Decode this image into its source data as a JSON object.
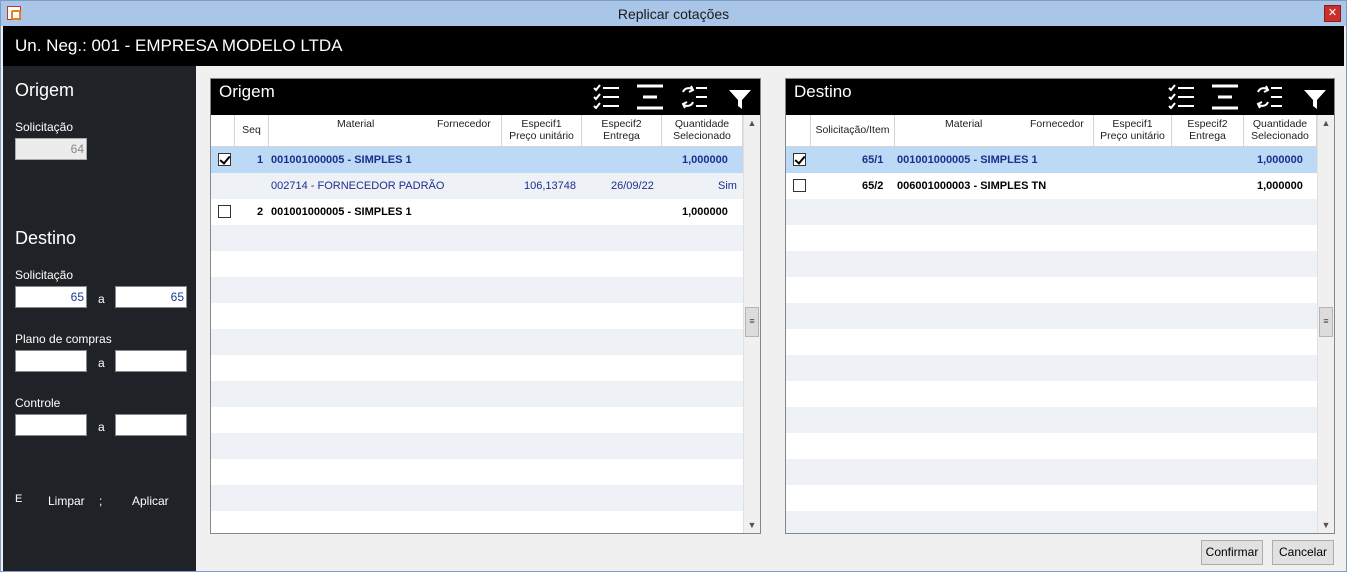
{
  "window": {
    "title": "Replicar cotações"
  },
  "company": {
    "label": "Un. Neg.:  001 - EMPRESA MODELO LTDA"
  },
  "sidebar": {
    "origem_title": "Origem",
    "origem_solicitacao_label": "Solicitação",
    "origem_solicitacao_value": "64",
    "destino_title": "Destino",
    "destino_solicitacao_label": "Solicitação",
    "destino_solicitacao_from": "65",
    "destino_solicitacao_to": "65",
    "plano_label": "Plano de compras",
    "plano_from": "",
    "plano_to": "",
    "controle_label": "Controle",
    "controle_from": "",
    "controle_to": "",
    "range_sep": "a",
    "link_e": "E",
    "link_limpar": "Limpar",
    "link_semicolon": ";",
    "link_aplicar": "Aplicar"
  },
  "origem_grid": {
    "title": "Origem",
    "columns": {
      "seq": "Seq",
      "material": "Material",
      "fornecedor": "Fornecedor",
      "espec1": "Especif1",
      "preco": "Preço unitário",
      "espec2": "Especif2",
      "entrega": "Entrega",
      "quantidade": "Quantidade",
      "selecionado": "Selecionado"
    },
    "rows": [
      {
        "seq": "1",
        "material": "001001000005 - SIMPLES 1",
        "quantidade": "1,000000",
        "checked": true
      },
      {
        "fornecedor": "002714 - FORNECEDOR PADRÃO",
        "preco": "106,13748",
        "entrega": "26/09/22",
        "selecionado": "Sim"
      },
      {
        "seq": "2",
        "material": "001001000005 - SIMPLES 1",
        "quantidade": "1,000000",
        "checked": false
      }
    ]
  },
  "destino_grid": {
    "title": "Destino",
    "columns": {
      "solicitacao_item": "Solicitação/Item",
      "material": "Material",
      "fornecedor": "Fornecedor",
      "espec1": "Especif1",
      "preco": "Preço unitário",
      "espec2": "Especif2",
      "entrega": "Entrega",
      "quantidade": "Quantidade",
      "selecionado": "Selecionado"
    },
    "rows": [
      {
        "item": "65/1",
        "material": "001001000005 - SIMPLES 1",
        "quantidade": "1,000000",
        "checked": true
      },
      {
        "item": "65/2",
        "material": "006001000003 - SIMPLES TN",
        "quantidade": "1,000000",
        "checked": false
      }
    ]
  },
  "buttons": {
    "confirmar": "Confirmar",
    "cancelar": "Cancelar"
  },
  "icons": {
    "check_all": "check-list-icon",
    "collapse": "align-lines-icon",
    "refresh": "refresh-list-icon",
    "filter": "filter-icon"
  }
}
